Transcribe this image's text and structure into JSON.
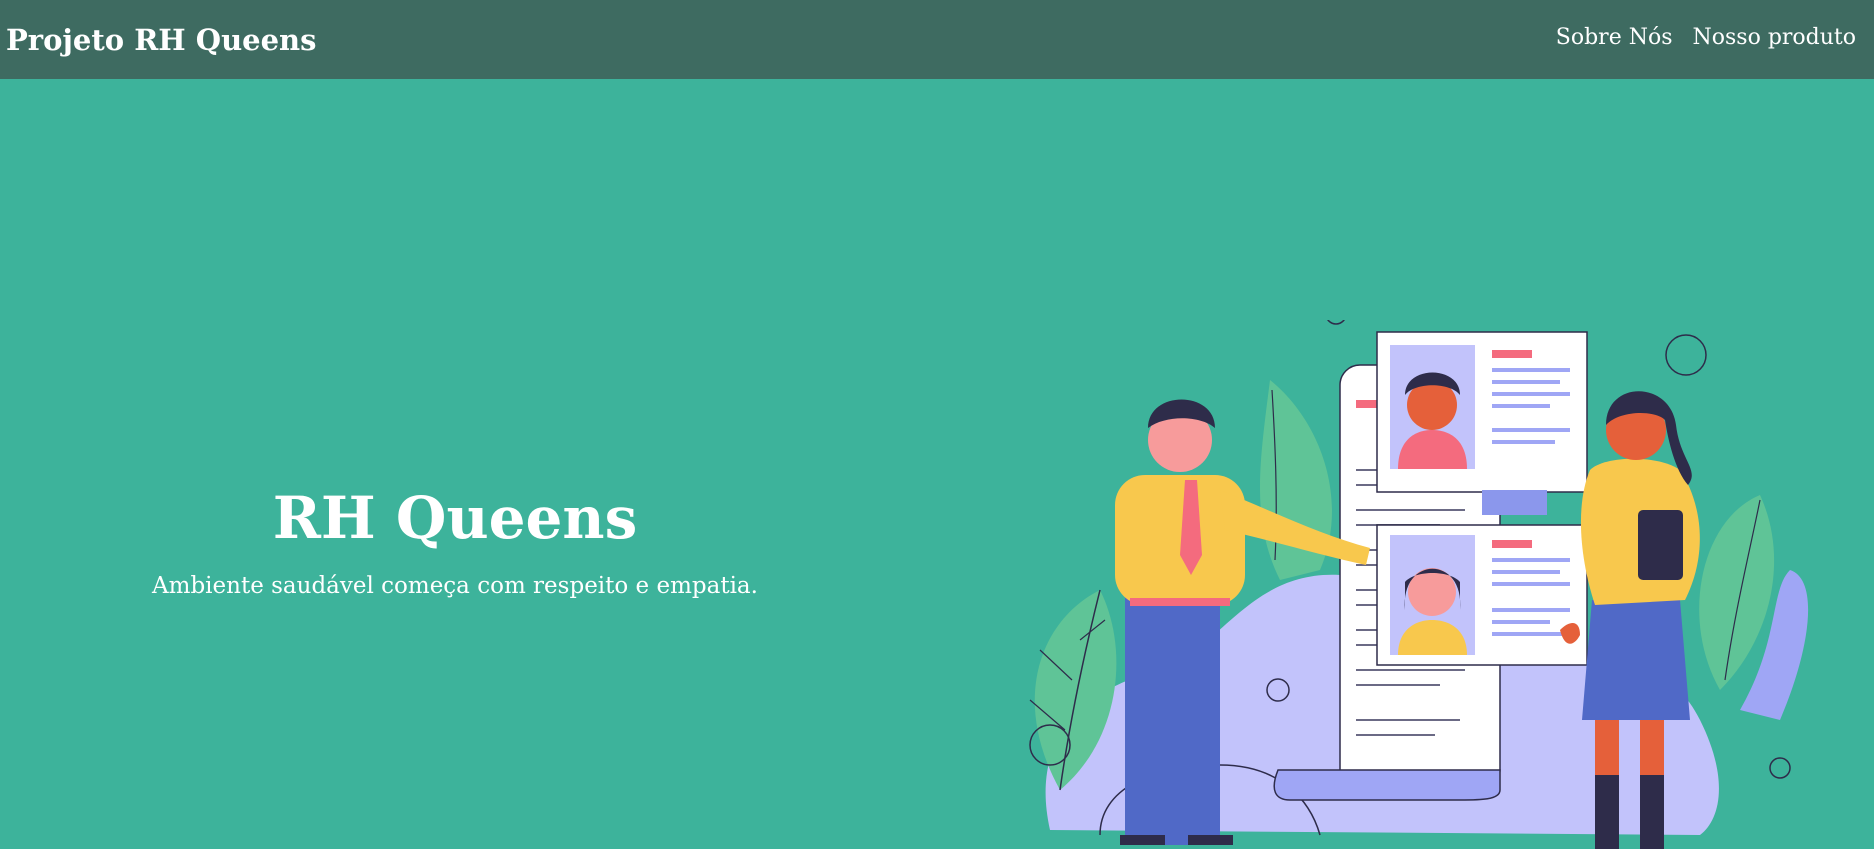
{
  "navbar": {
    "brand": "Projeto RH Queens",
    "links": [
      "Sobre Nós",
      "Nosso produto"
    ]
  },
  "hero": {
    "title": "RH Queens",
    "subtitle": "Ambiente saudável começa com respeito e empatia."
  },
  "colors": {
    "navbar_bg": "#3e6b61",
    "hero_bg": "#3db39b",
    "text": "#ffffff"
  }
}
